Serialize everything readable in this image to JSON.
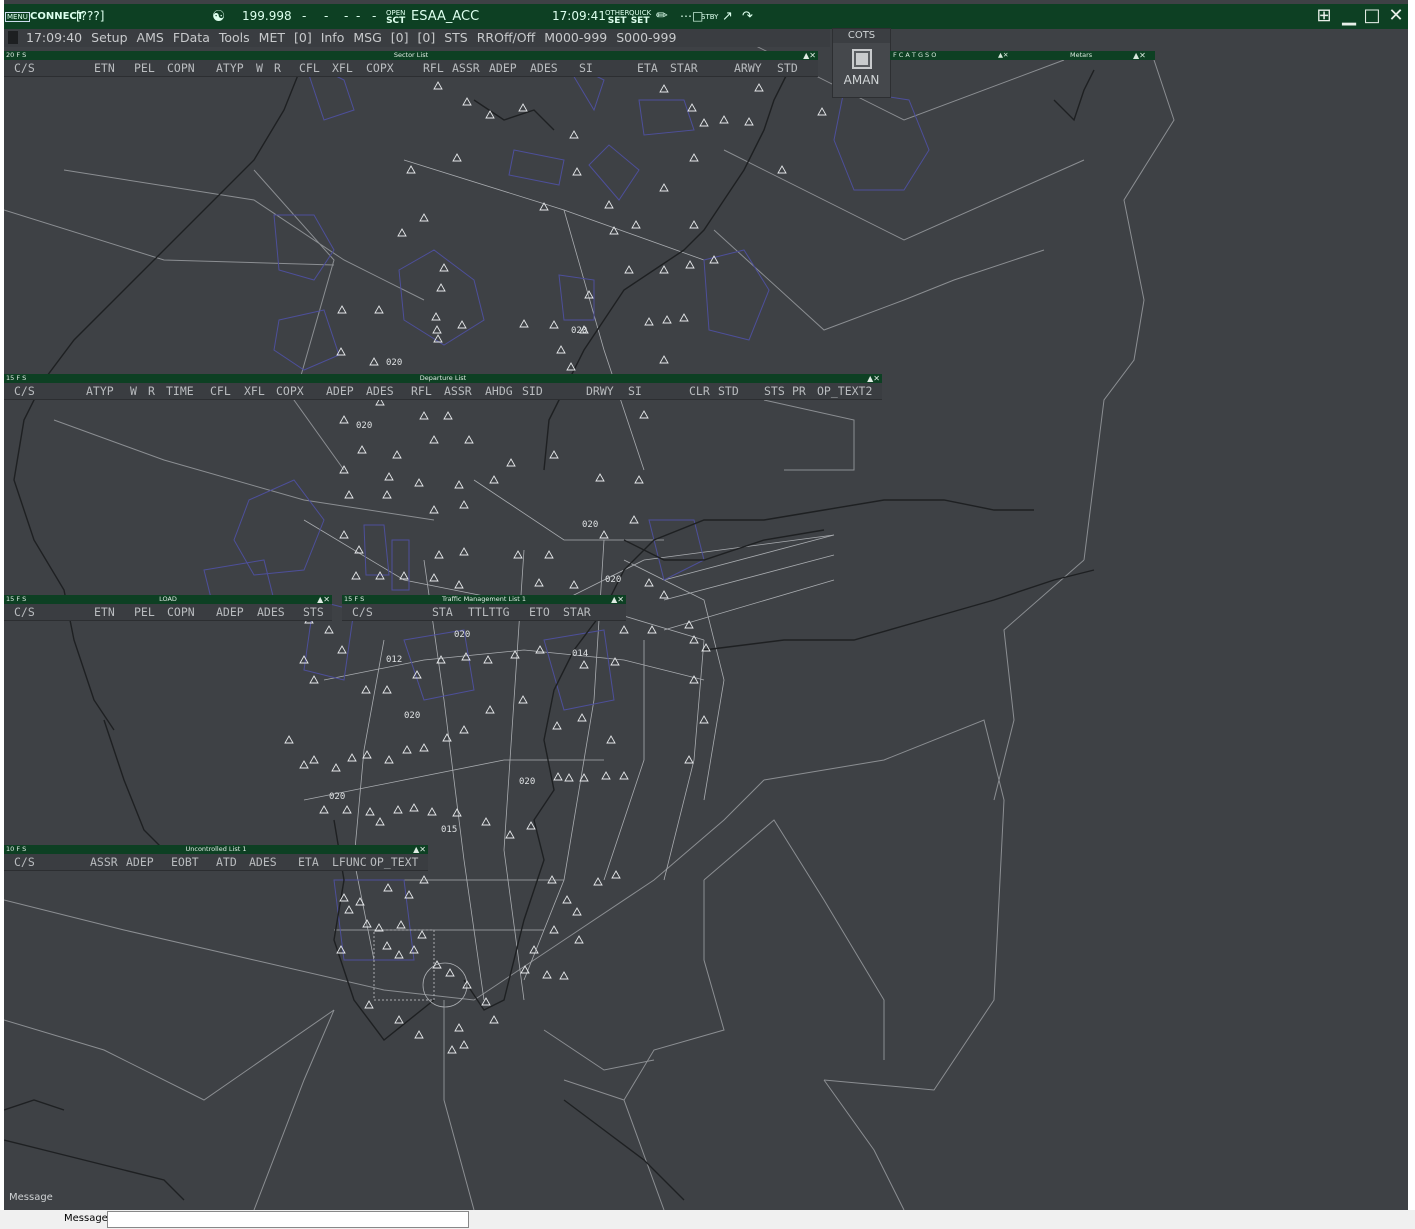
{
  "topbar": {
    "menu_label": "MENU",
    "connect_label": "CONNECT",
    "connect_status": "[???]",
    "frequency": "199.998",
    "dashes": [
      "-",
      "-",
      "-",
      "-",
      "-"
    ],
    "open_label": "OPEN",
    "sct_label": "SCT",
    "sector": "ESAA_ACC",
    "clock": "17:09:41",
    "other_label": "OTHER",
    "quick_label": "QUICK",
    "set_label": "SET",
    "stby_label": "STBY"
  },
  "menubar": {
    "time": "17:09:40",
    "items": [
      "Setup",
      "AMS",
      "FData",
      "Tools",
      "MET",
      "[0]",
      "Info",
      "MSG",
      "[0]",
      "[0]",
      "STS",
      "RROff/Off",
      "M000-999",
      "S000-999"
    ]
  },
  "cots": {
    "title": "COTS",
    "label": "AMAN"
  },
  "sector_list": {
    "count": "20",
    "flags": "F  S",
    "title": "Sector List",
    "columns": [
      "C/S",
      "ETN",
      "PEL",
      "COPN",
      "ATYP",
      "W",
      "R",
      "CFL",
      "XFL",
      "COPX",
      "RFL",
      "ASSR",
      "ADEP",
      "ADES",
      "SI",
      "ETA",
      "STAR",
      "ARWY",
      "STD"
    ]
  },
  "departure_list": {
    "count": "15",
    "flags": "F  S",
    "title": "Departure List",
    "columns": [
      "C/S",
      "ATYP",
      "W",
      "R",
      "TIME",
      "CFL",
      "XFL",
      "COPX",
      "ADEP",
      "ADES",
      "RFL",
      "ASSR",
      "AHDG",
      "SID",
      "DRWY",
      "SI",
      "CLR",
      "STD",
      "STS",
      "PR",
      "OP_TEXT2"
    ]
  },
  "load_list": {
    "count": "15",
    "flags": "F  S",
    "title": "LOAD",
    "columns": [
      "C/S",
      "ETN",
      "PEL",
      "COPN",
      "ADEP",
      "ADES",
      "STS"
    ]
  },
  "tm_list": {
    "count": "15",
    "flags": "F  S",
    "title": "Traffic Management List 1",
    "columns": [
      "C/S",
      "STA",
      "TTLTTG",
      "ETO",
      "STAR"
    ]
  },
  "uncontrolled_list": {
    "count": "10",
    "flags": "F  S",
    "title": "Uncontrolled List 1",
    "columns": [
      "C/S",
      "ASSR",
      "ADEP",
      "EOBT",
      "ATD",
      "ADES",
      "ETA",
      "LFUNC",
      "OP_TEXT"
    ]
  },
  "metars_strip": {
    "flags": "F C A T G S O",
    "title": "Metars"
  },
  "map_labels": [
    "020",
    "020",
    "020",
    "020",
    "020",
    "020",
    "012",
    "014",
    "020",
    "020",
    "020",
    "015"
  ],
  "message": {
    "map_label": "Message",
    "bar_label": "Message",
    "value": ""
  },
  "colors": {
    "map_bg": "#3e4145",
    "bar_green": "#0d4023",
    "airspace_blue": "#4d4f9a",
    "border_grey": "#8b8e92",
    "coast": "#1e2022"
  }
}
